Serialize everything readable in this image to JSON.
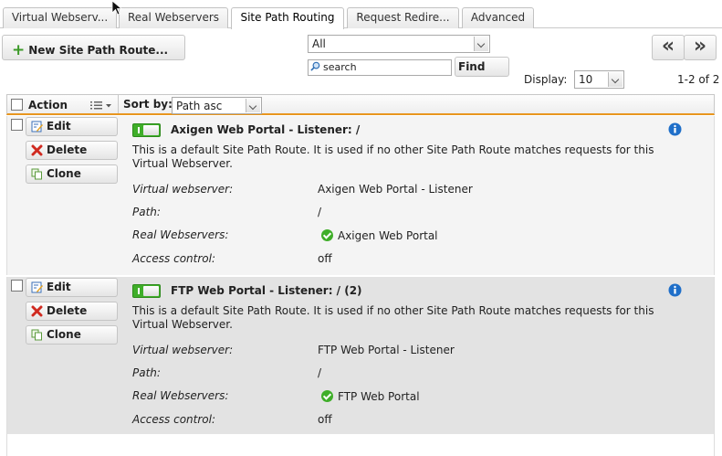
{
  "tabs": [
    {
      "label": "Virtual Webserv..."
    },
    {
      "label": "Real Webservers"
    },
    {
      "label": "Site Path Routing"
    },
    {
      "label": "Request Redire..."
    },
    {
      "label": "Advanced"
    }
  ],
  "active_tab": "Site Path Routing",
  "toolbar": {
    "new_label": "New Site Path Route...",
    "filter_value": "All",
    "search_placeholder": "search",
    "find_label": "Find",
    "prev_label": "«",
    "next_label": "»",
    "display_label": "Display:",
    "display_value": "10",
    "range_text": "1-2 of 2"
  },
  "list_header": {
    "action_label": "Action",
    "sortby_label": "Sort by:",
    "sort_value": "Path asc"
  },
  "row_actions": {
    "edit": "Edit",
    "delete": "Delete",
    "clone": "Clone"
  },
  "field_labels": {
    "virtual_webserver": "Virtual webserver:",
    "path": "Path:",
    "real_webservers": "Real Webservers:",
    "access_control": "Access control:"
  },
  "rows": [
    {
      "title": "Axigen Web Portal - Listener: /",
      "enabled": true,
      "description": "This is a default Site Path Route. It is used if no other Site Path Route matches requests for this Virtual Webserver.",
      "virtual_webserver": "Axigen Web Portal - Listener",
      "path": "/",
      "real_webservers": "Axigen Web Portal",
      "access_control": "off"
    },
    {
      "title": "FTP Web Portal - Listener: / (2)",
      "enabled": true,
      "description": "This is a default Site Path Route. It is used if no other Site Path Route matches requests for this Virtual Webserver.",
      "virtual_webserver": "FTP Web Portal - Listener",
      "path": "/",
      "real_webservers": "FTP Web Portal",
      "access_control": "off"
    }
  ],
  "colors": {
    "accent_orange": "#e8961f",
    "toggle_green": "#3fae29",
    "info_blue": "#1f6fc9",
    "delete_red": "#d02a20"
  }
}
